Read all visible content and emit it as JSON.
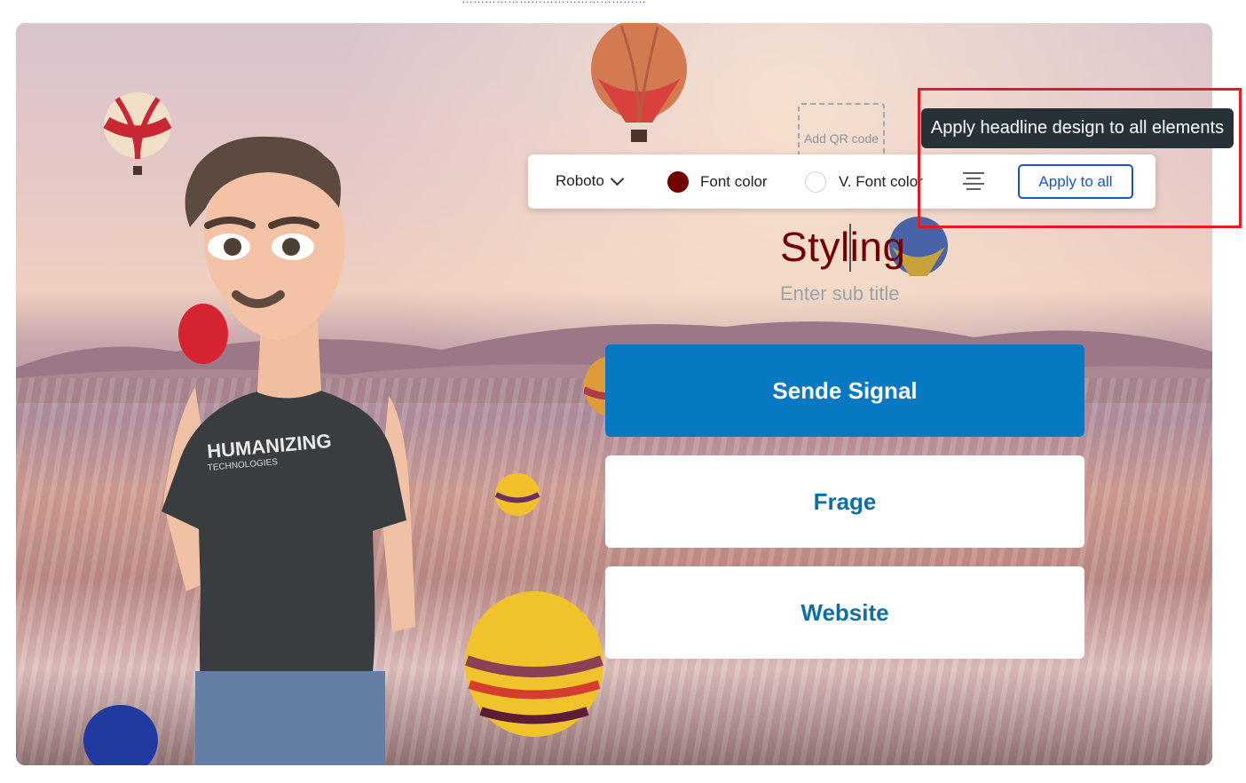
{
  "toolbar": {
    "font_family": "Roboto",
    "font_color_label": "Font color",
    "font_color_value": "#720000",
    "v_font_color_label": "V. Font color",
    "v_font_color_value": "#ffffff",
    "alignment": "center",
    "alignment_icon": "align-center-icon",
    "apply_label": "Apply to all"
  },
  "tooltip": {
    "text": "Apply headline design to all elements"
  },
  "qr": {
    "label": "Add QR code"
  },
  "content": {
    "headline": "Styling",
    "subtitle_placeholder": "Enter sub title"
  },
  "buttons": [
    {
      "label": "Sende Signal",
      "style": "primary"
    },
    {
      "label": "Frage",
      "style": "secondary"
    },
    {
      "label": "Website",
      "style": "secondary"
    }
  ],
  "avatar": {
    "shirt_text": "HUMANIZING",
    "shirt_subtext": "TECHNOLOGIES"
  },
  "colors": {
    "primary_button": "#0679c2",
    "secondary_text": "#0b6fa8",
    "headline": "#720000",
    "highlight": "#e51b23",
    "apply_button": "#1a56c8"
  }
}
